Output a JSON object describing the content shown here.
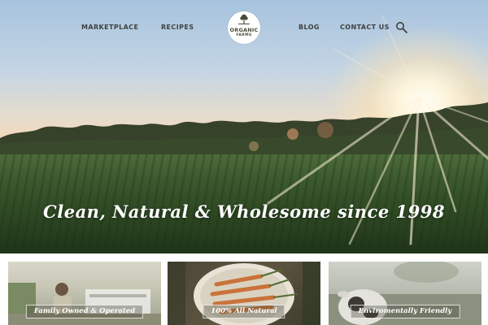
{
  "nav": {
    "items": [
      {
        "label": "MARKETPLACE"
      },
      {
        "label": "RECIPES"
      },
      {
        "label": "BLOG"
      },
      {
        "label": "CONTACT US"
      }
    ],
    "logo": {
      "line1": "ORGANIC",
      "line2": "FARMS"
    },
    "search_icon": "search-icon"
  },
  "hero": {
    "tagline": "Clean, Natural & Wholesome since 1998"
  },
  "cards": [
    {
      "label": "Family Owned & Operated"
    },
    {
      "label": "100% All Natural"
    },
    {
      "label": "Enviromentally Friendly"
    }
  ],
  "colors": {
    "nav_text": "#3f4140",
    "tagline": "#ffffff"
  }
}
